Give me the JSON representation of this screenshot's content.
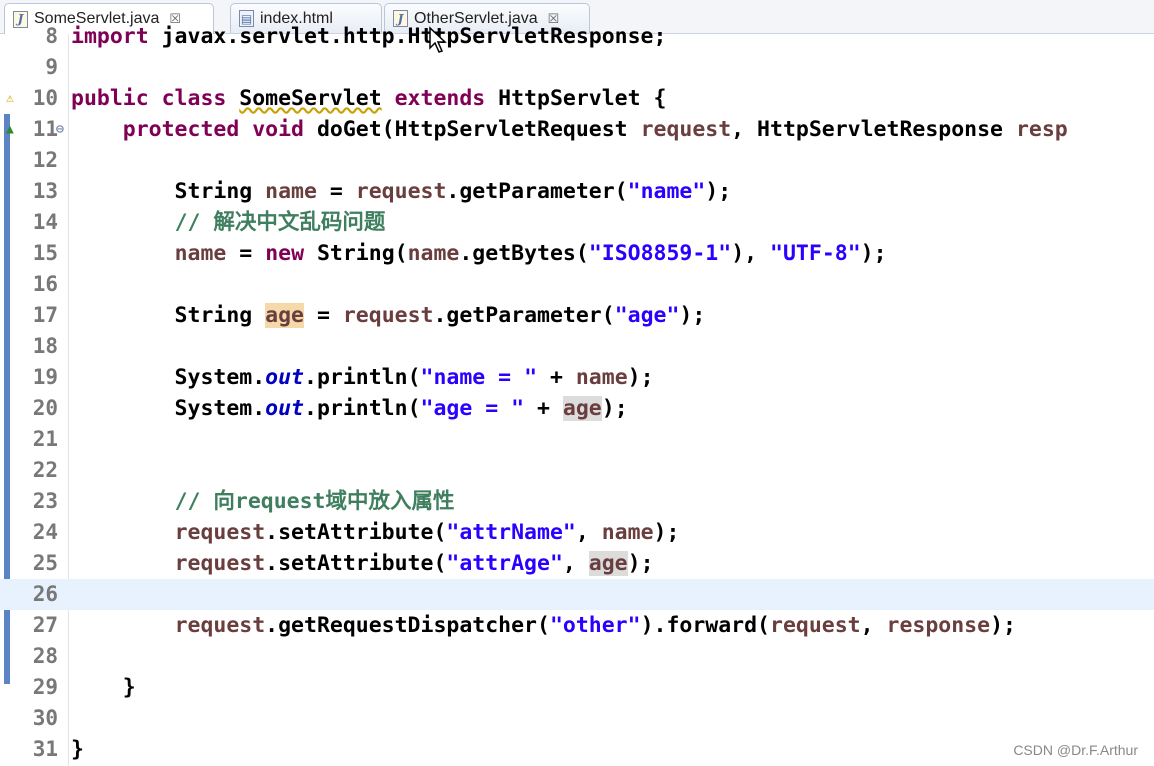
{
  "tabs": [
    {
      "label": "SomeServlet.java",
      "icon": "java-file-icon",
      "close": "☒",
      "active": true
    },
    {
      "label": "index.html",
      "icon": "html-file-icon",
      "close": "",
      "active": false
    },
    {
      "label": "OtherServlet.java",
      "icon": "java-file-icon",
      "close": "☒",
      "active": false
    }
  ],
  "editor": {
    "lines": [
      {
        "n": "8",
        "tokens": [
          [
            "kw",
            "import"
          ],
          [
            "t",
            " javax.servlet.http.HttpServletResponse;"
          ]
        ]
      },
      {
        "n": "9",
        "tokens": []
      },
      {
        "n": "10",
        "tokens": [
          [
            "kw",
            "public class "
          ],
          [
            "t",
            "SomeServlet"
          ],
          [
            "kw",
            " extends "
          ],
          [
            "t",
            "HttpServlet {"
          ]
        ]
      },
      {
        "n": "11",
        "tokens": [
          [
            "t",
            "    "
          ],
          [
            "kw",
            "protected void "
          ],
          [
            "t",
            "doGet(HttpServletRequest "
          ],
          [
            "var",
            "request"
          ],
          [
            "t",
            ", HttpServletResponse "
          ],
          [
            "var",
            "resp"
          ]
        ]
      },
      {
        "n": "12",
        "tokens": []
      },
      {
        "n": "13",
        "tokens": [
          [
            "t",
            "        String "
          ],
          [
            "var",
            "name"
          ],
          [
            "t",
            " = "
          ],
          [
            "var",
            "request"
          ],
          [
            "t",
            ".getParameter("
          ],
          [
            "str",
            "\"name\""
          ],
          [
            "t",
            ");"
          ]
        ]
      },
      {
        "n": "14",
        "tokens": [
          [
            "t",
            "        "
          ],
          [
            "cm",
            "// 解决中文乱码问题"
          ]
        ]
      },
      {
        "n": "15",
        "tokens": [
          [
            "t",
            "        "
          ],
          [
            "var",
            "name"
          ],
          [
            "t",
            " = "
          ],
          [
            "kw",
            "new "
          ],
          [
            "t",
            "String("
          ],
          [
            "var",
            "name"
          ],
          [
            "t",
            ".getBytes("
          ],
          [
            "str",
            "\"ISO8859-1\""
          ],
          [
            "t",
            "), "
          ],
          [
            "str",
            "\"UTF-8\""
          ],
          [
            "t",
            ");"
          ]
        ]
      },
      {
        "n": "16",
        "tokens": []
      },
      {
        "n": "17",
        "tokens": [
          [
            "t",
            "        String "
          ],
          [
            "varw",
            "age"
          ],
          [
            "t",
            " = "
          ],
          [
            "var",
            "request"
          ],
          [
            "t",
            ".getParameter("
          ],
          [
            "str",
            "\"age\""
          ],
          [
            "t",
            ");"
          ]
        ]
      },
      {
        "n": "18",
        "tokens": []
      },
      {
        "n": "19",
        "tokens": [
          [
            "t",
            "        System."
          ],
          [
            "fld",
            "out"
          ],
          [
            "t",
            ".println("
          ],
          [
            "str",
            "\"name = \""
          ],
          [
            "t",
            " + "
          ],
          [
            "var",
            "name"
          ],
          [
            "t",
            ");"
          ]
        ]
      },
      {
        "n": "20",
        "tokens": [
          [
            "t",
            "        System."
          ],
          [
            "fld",
            "out"
          ],
          [
            "t",
            ".println("
          ],
          [
            "str",
            "\"age = \""
          ],
          [
            "t",
            " + "
          ],
          [
            "varr",
            "age"
          ],
          [
            "t",
            ");"
          ]
        ]
      },
      {
        "n": "21",
        "tokens": []
      },
      {
        "n": "22",
        "tokens": []
      },
      {
        "n": "23",
        "tokens": [
          [
            "t",
            "        "
          ],
          [
            "cm",
            "// 向request域中放入属性"
          ]
        ]
      },
      {
        "n": "24",
        "tokens": [
          [
            "t",
            "        "
          ],
          [
            "var",
            "request"
          ],
          [
            "t",
            ".setAttribute("
          ],
          [
            "str",
            "\"attrName\""
          ],
          [
            "t",
            ", "
          ],
          [
            "var",
            "name"
          ],
          [
            "t",
            ");"
          ]
        ]
      },
      {
        "n": "25",
        "tokens": [
          [
            "t",
            "        "
          ],
          [
            "var",
            "request"
          ],
          [
            "t",
            ".setAttribute("
          ],
          [
            "str",
            "\"attrAge\""
          ],
          [
            "t",
            ", "
          ],
          [
            "varr",
            "age"
          ],
          [
            "t",
            ");"
          ]
        ]
      },
      {
        "n": "26",
        "tokens": [],
        "current": true
      },
      {
        "n": "27",
        "tokens": [
          [
            "t",
            "        "
          ],
          [
            "var",
            "request"
          ],
          [
            "t",
            ".getRequestDispatcher("
          ],
          [
            "str",
            "\"other\""
          ],
          [
            "t",
            ").forward("
          ],
          [
            "var",
            "request"
          ],
          [
            "t",
            ", "
          ],
          [
            "var",
            "response"
          ],
          [
            "t",
            ");"
          ]
        ]
      },
      {
        "n": "28",
        "tokens": []
      },
      {
        "n": "29",
        "tokens": [
          [
            "t",
            "    }"
          ]
        ]
      },
      {
        "n": "30",
        "tokens": []
      },
      {
        "n": "31",
        "tokens": [
          [
            "t",
            "}"
          ]
        ]
      }
    ]
  },
  "watermark": "CSDN @Dr.F.Arthur"
}
